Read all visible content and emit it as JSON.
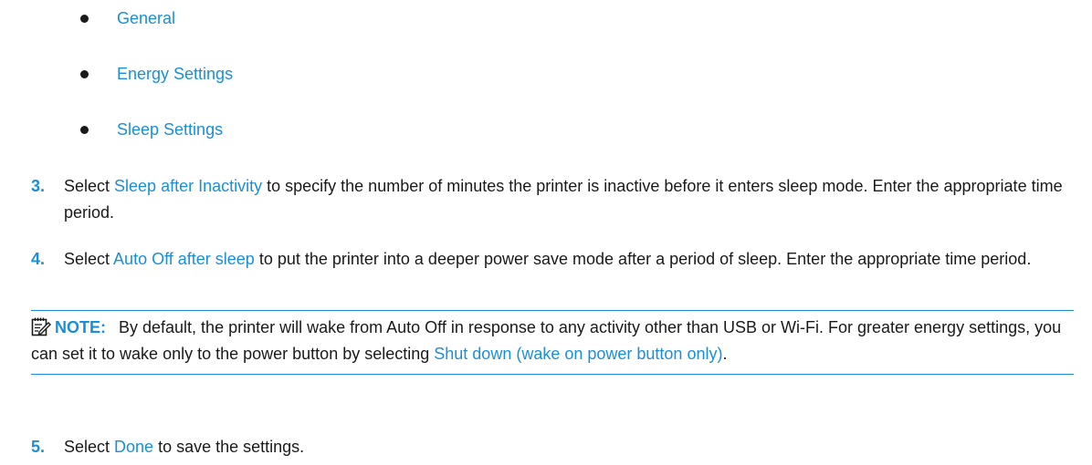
{
  "bullets": [
    {
      "label": "General"
    },
    {
      "label": "Energy Settings"
    },
    {
      "label": "Sleep Settings"
    }
  ],
  "steps": [
    {
      "number": "3.",
      "pre": "Select ",
      "link": "Sleep after Inactivity",
      "post": " to specify the number of minutes the printer is inactive before it enters sleep mode. Enter the appropriate time period."
    },
    {
      "number": "4.",
      "pre": "Select ",
      "link": "Auto Off after sleep",
      "post": " to put the printer into a deeper power save mode after a period of sleep. Enter the appropriate time period."
    },
    {
      "number": "5.",
      "pre": "Select ",
      "link": "Done",
      "post": " to save the settings."
    }
  ],
  "note": {
    "icon": "note-pencil-icon",
    "label": "NOTE:",
    "text": "By default, the printer will wake from Auto Off in response to any activity other than USB or Wi-Fi. For greater energy settings, you can set it to wake only to the power button by selecting ",
    "link": "Shut down (wake on power button only)",
    "end": "."
  },
  "colors": {
    "accent": "#1a8fd8",
    "text": "#1a1a1a"
  }
}
